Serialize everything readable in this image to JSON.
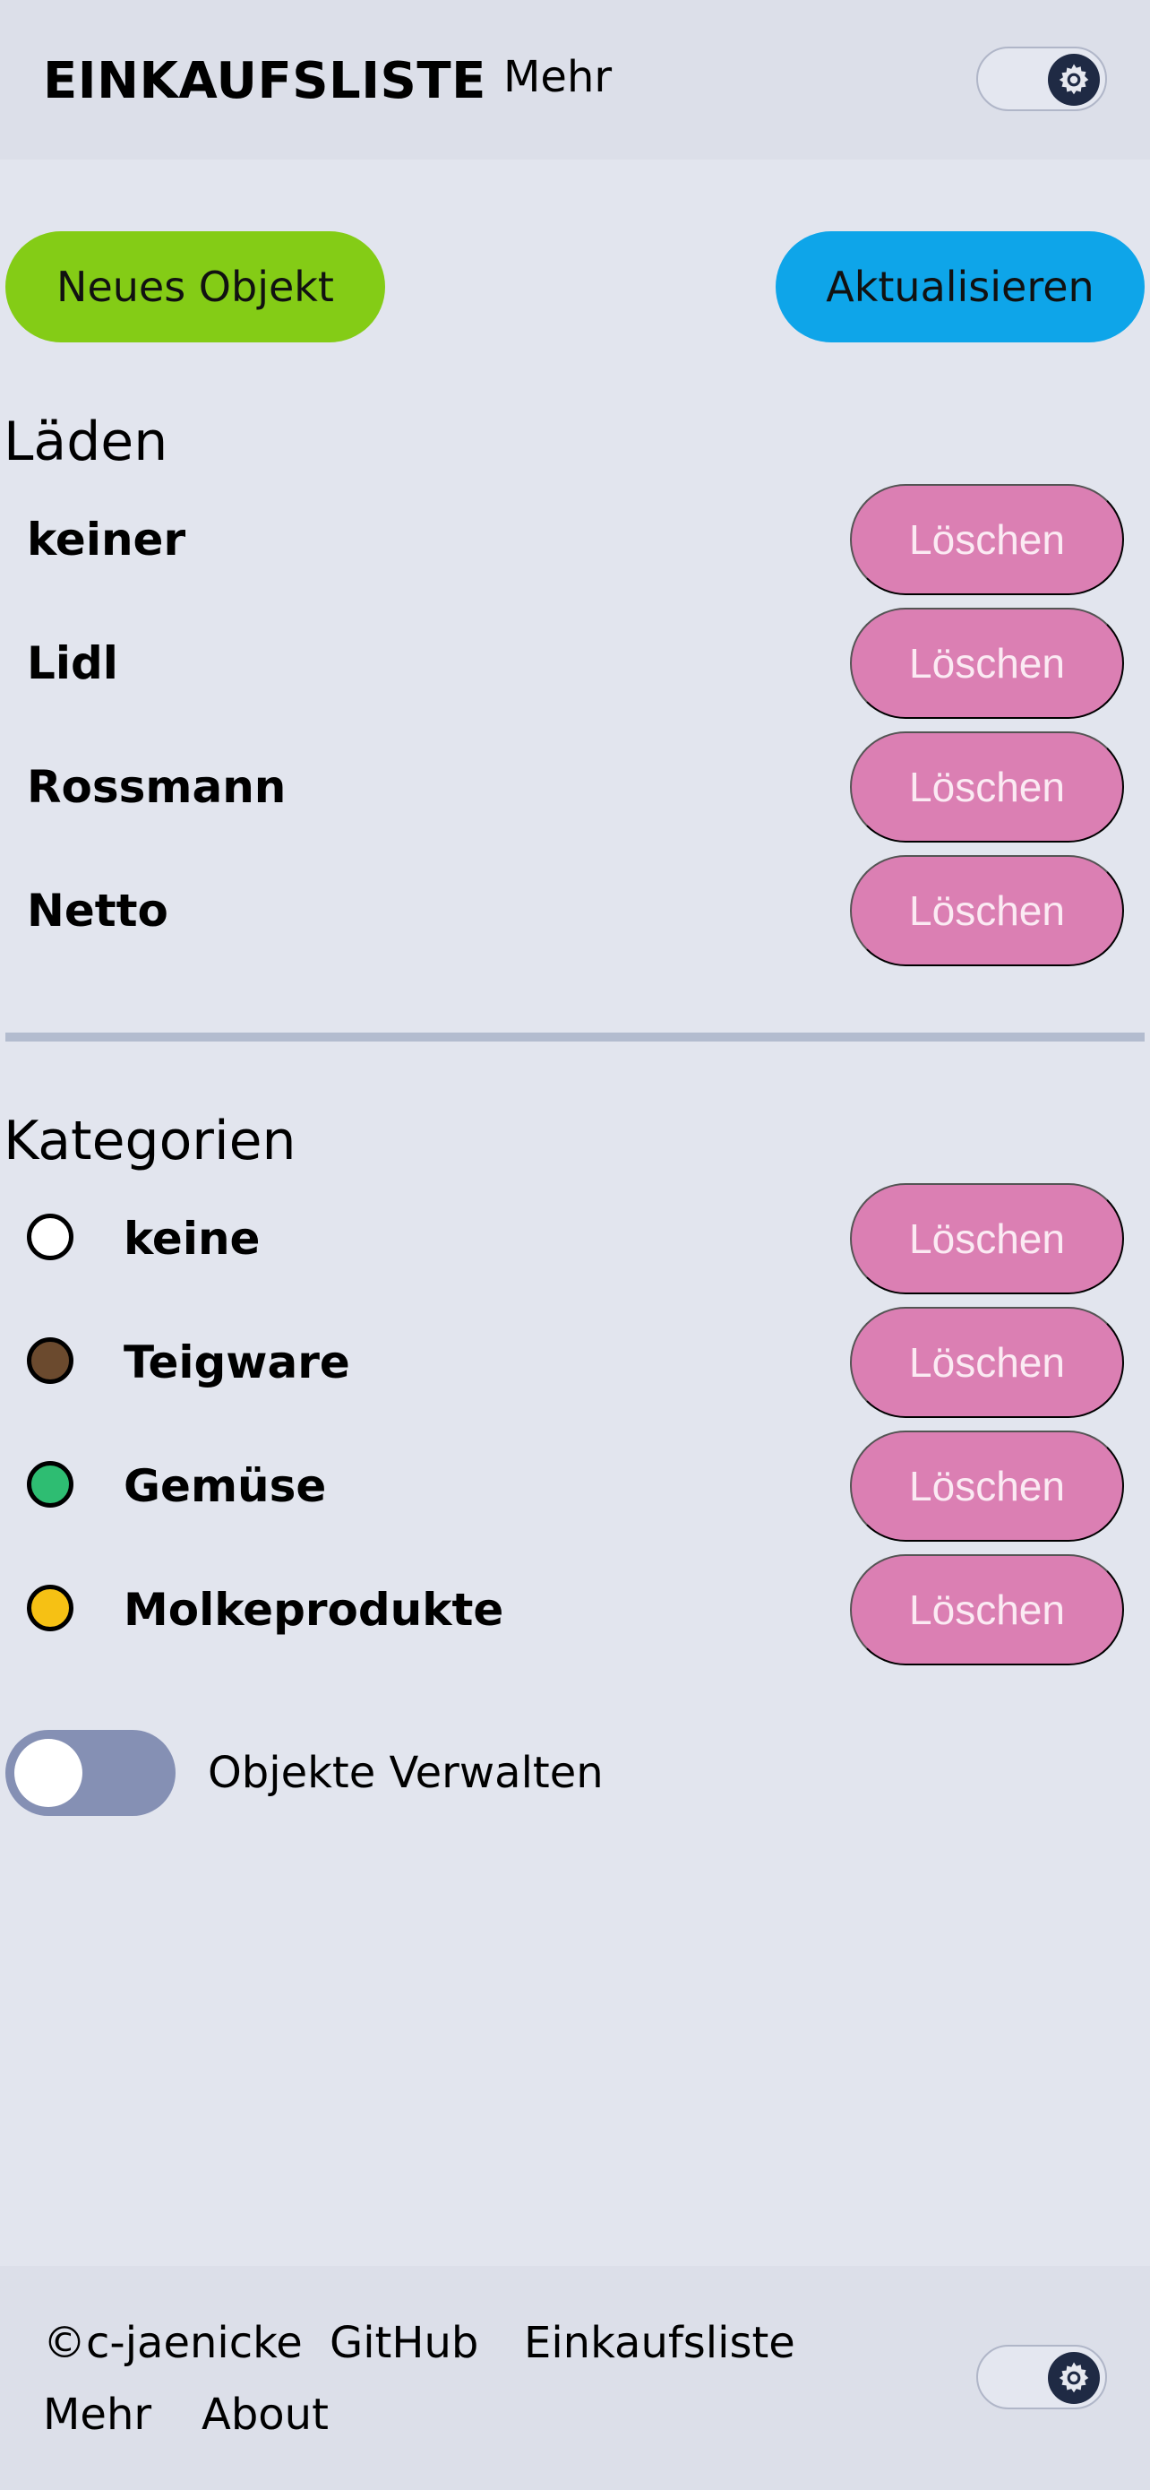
{
  "header": {
    "title": "EINKAUFSLISTE",
    "more_label": "Mehr",
    "theme_toggle_icon": "gear-icon"
  },
  "actions": {
    "new_item_label": "Neues Objekt",
    "refresh_label": "Aktualisieren",
    "new_item_color": "#84cc16",
    "refresh_color": "#0ea5e9"
  },
  "stores": {
    "title": "Läden",
    "items": [
      {
        "name": "keiner",
        "delete_label": "Löschen"
      },
      {
        "name": "Lidl",
        "delete_label": "Löschen"
      },
      {
        "name": "Rossmann",
        "delete_label": "Löschen"
      },
      {
        "name": "Netto",
        "delete_label": "Löschen"
      }
    ]
  },
  "categories": {
    "title": "Kategorien",
    "items": [
      {
        "name": "keine",
        "color": "#ffffff",
        "delete_label": "Löschen"
      },
      {
        "name": "Teigware",
        "color": "#6b4a2e",
        "delete_label": "Löschen"
      },
      {
        "name": "Gemüse",
        "color": "#2ebd72",
        "delete_label": "Löschen"
      },
      {
        "name": "Molkeprodukte",
        "color": "#f6c114",
        "delete_label": "Löschen"
      }
    ]
  },
  "manage_toggle": {
    "label": "Objekte Verwalten",
    "checked": false
  },
  "footer": {
    "copyright": "©c-jaenicke",
    "github": "GitHub",
    "app": "Einkaufsliste",
    "more": "Mehr",
    "about": "About"
  },
  "colors": {
    "delete_button": "#db7fb3",
    "background": "#e2e5ee"
  }
}
